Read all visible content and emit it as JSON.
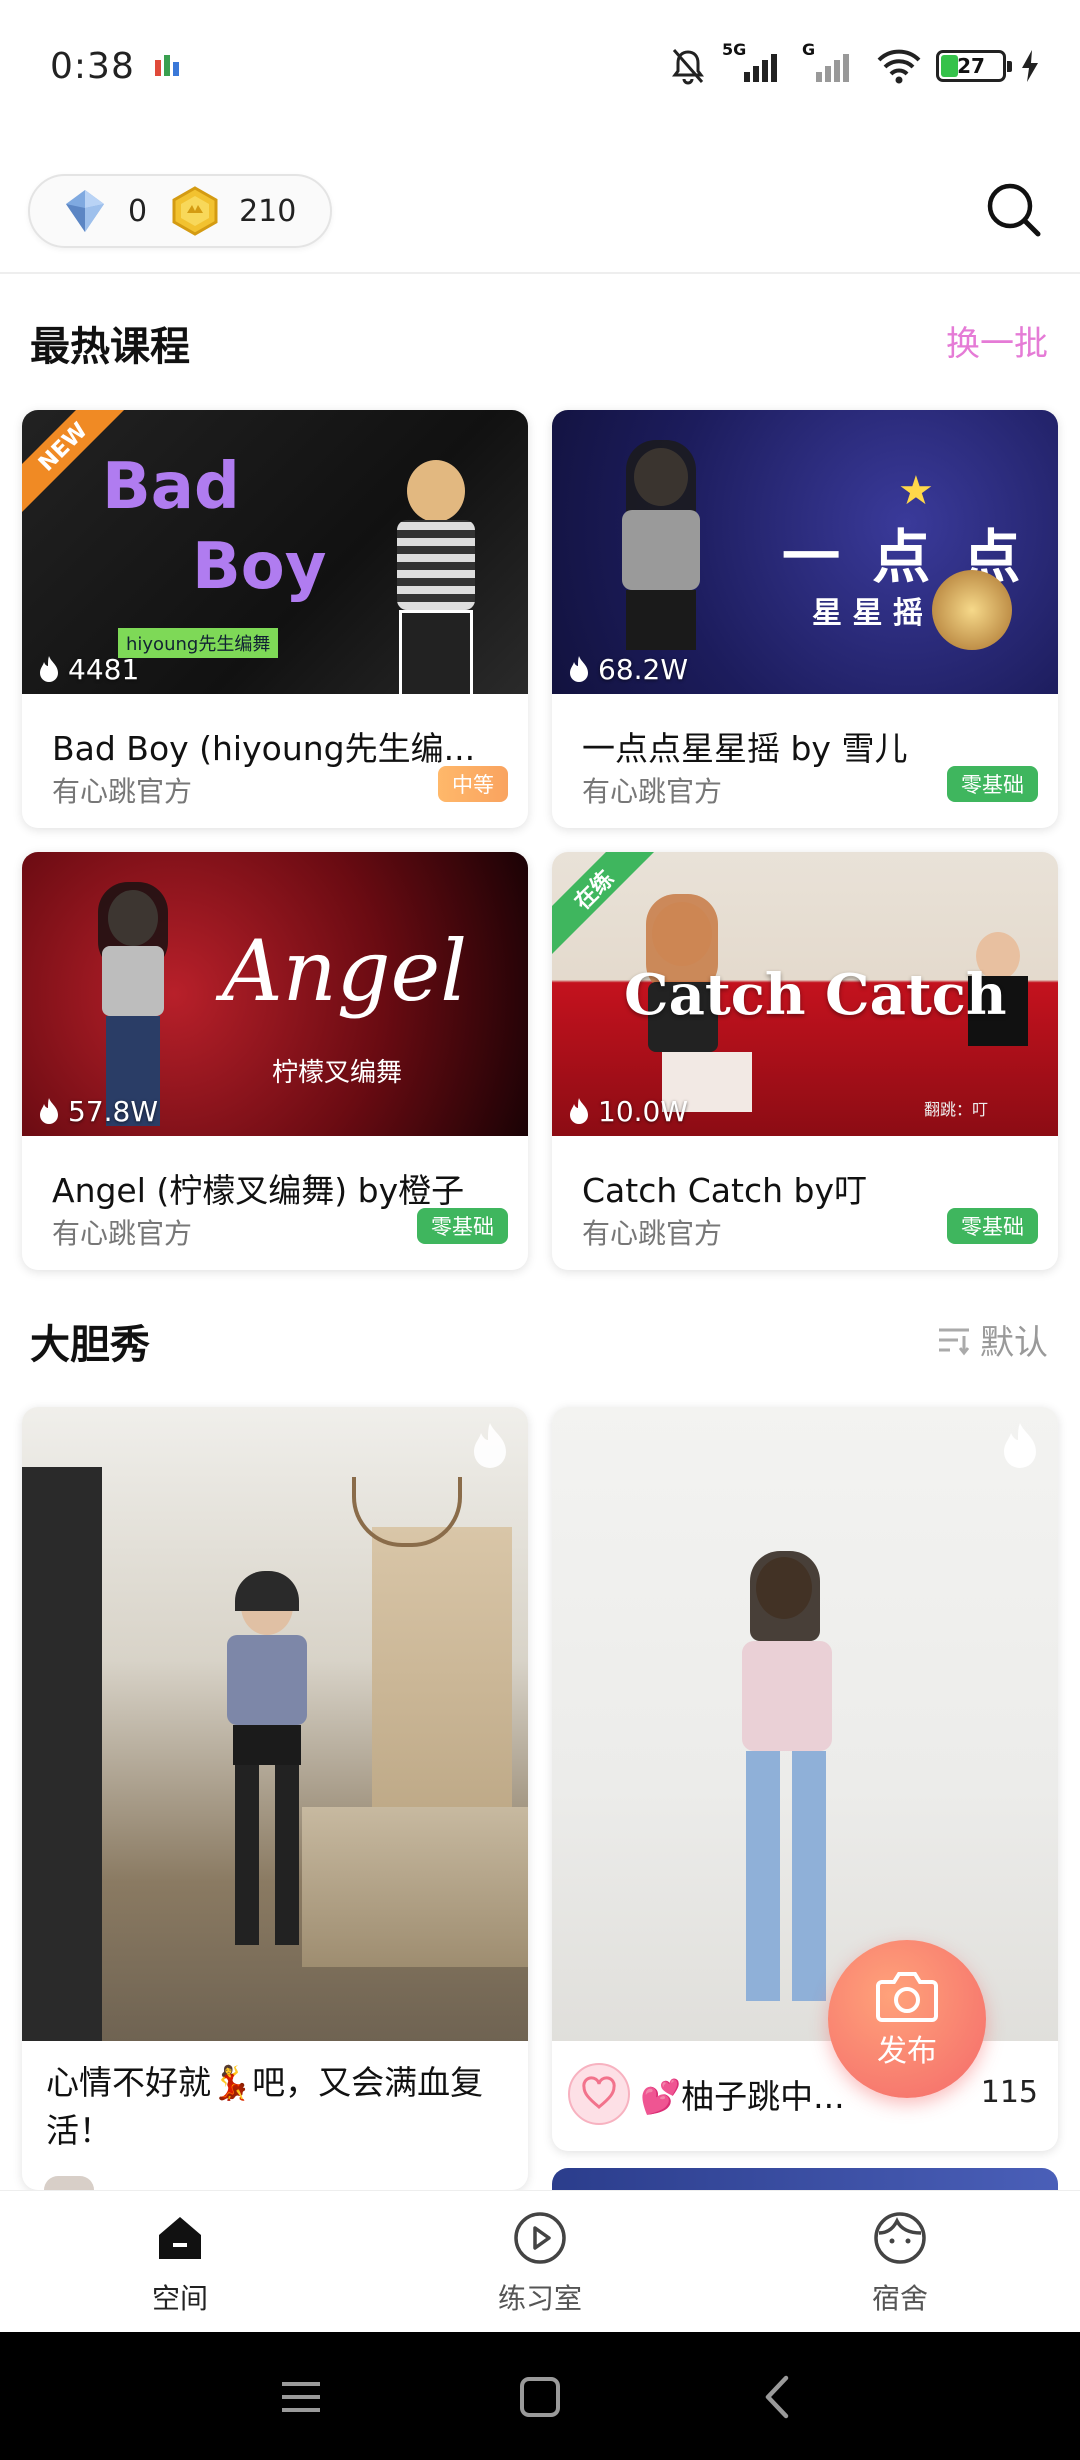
{
  "status_bar": {
    "time": "0:38",
    "network": "5G",
    "network2": "G",
    "battery": "27",
    "battery_level": 0.27
  },
  "header": {
    "diamond_count": "0",
    "coin_count": "210",
    "icons": {
      "diamond": "diamond-icon",
      "coin": "coin-icon",
      "search": "search-icon"
    }
  },
  "hot_courses": {
    "title": "最热课程",
    "refresh_label": "换一批",
    "items": [
      {
        "title": "Bad Boy (hiyoung先生编...",
        "author": "有心跳官方",
        "heat": "4481",
        "level": "中等",
        "ribbon": "NEW",
        "thumb_text1": "Bad",
        "thumb_text2": "Boy",
        "thumb_tag": "hiyoung先生编舞"
      },
      {
        "title": "一点点星星摇 by 雪儿",
        "author": "有心跳官方",
        "heat": "68.2W",
        "level": "零基础",
        "thumb_text1": "一 点 点",
        "thumb_text2": "星 星 摇"
      },
      {
        "title": "Angel (柠檬叉编舞) by橙子",
        "author": "有心跳官方",
        "heat": "57.8W",
        "level": "零基础",
        "thumb_text1": "Angel",
        "thumb_text2": "柠檬叉编舞"
      },
      {
        "title": "Catch Catch by叮",
        "author": "有心跳官方",
        "heat": "10.0W",
        "level": "零基础",
        "ribbon": "在练",
        "thumb_text1": "Catch Catch",
        "thumb_text2": "翻跳：叮"
      }
    ]
  },
  "showcase": {
    "title": "大胆秀",
    "sort_label": "默认",
    "items": [
      {
        "caption": "心情不好就💃吧，又会满血复活！"
      },
      {
        "username": "💕柚子跳中...",
        "likes": "115"
      }
    ]
  },
  "publish": {
    "label": "发布"
  },
  "bottom_nav": {
    "items": [
      {
        "label": "空间",
        "icon": "home-icon"
      },
      {
        "label": "练习室",
        "icon": "play-circle-icon"
      },
      {
        "label": "宿舍",
        "icon": "face-icon"
      }
    ]
  },
  "colors": {
    "accent_pink": "#e57bd6",
    "badge_orange": "#f9a35f",
    "badge_green": "#3fb65e",
    "publish": "#f46a6a"
  }
}
